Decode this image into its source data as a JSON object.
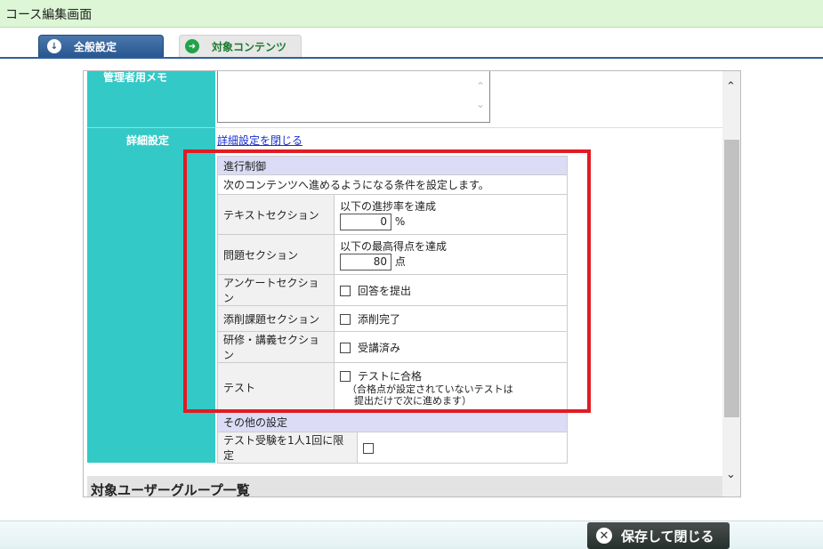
{
  "window": {
    "title": "コース編集画面"
  },
  "tabs": [
    {
      "label": "全般設定",
      "icon": "arrow-down-circle-icon"
    },
    {
      "label": "対象コンテンツ",
      "icon": "arrow-right-circle-icon"
    }
  ],
  "form": {
    "memo_label": "管理者用メモ",
    "detail_label": "詳細設定",
    "close_detail_link": "詳細設定を閉じる"
  },
  "progress_control": {
    "heading": "進行制御",
    "description": "次のコンテンツへ進めるようになる条件を設定します。",
    "rows": {
      "text_section": {
        "label": "テキストセクション",
        "condition": "以下の進捗率を達成",
        "value": "0",
        "unit": "%"
      },
      "question_section": {
        "label": "問題セクション",
        "condition": "以下の最高得点を達成",
        "value": "80",
        "unit": "点"
      },
      "survey_section": {
        "label": "アンケートセクション",
        "checkbox_label": "回答を提出",
        "checked": false
      },
      "assignment_section": {
        "label": "添削課題セクション",
        "checkbox_label": "添削完了",
        "checked": false
      },
      "training_section": {
        "label": "研修・講義セクション",
        "checkbox_label": "受講済み",
        "checked": false
      },
      "test": {
        "label": "テスト",
        "checkbox_label": "テストに合格",
        "checked": false,
        "note_line1": "（合格点が設定されていないテストは",
        "note_line2": "提出だけで次に進めます）"
      }
    }
  },
  "other_settings": {
    "heading": "その他の設定",
    "limit_label": "テスト受験を1人1回に限定",
    "limit_checked": false
  },
  "user_group_section": {
    "title": "対象ユーザーグループ一覧"
  },
  "footer": {
    "save_close_label": "保存して閉じる"
  },
  "colors": {
    "teal": "#33c9c6",
    "highlight_border": "#e01c24",
    "tab_active": "#285791",
    "title_bg": "#ddf7d6"
  }
}
